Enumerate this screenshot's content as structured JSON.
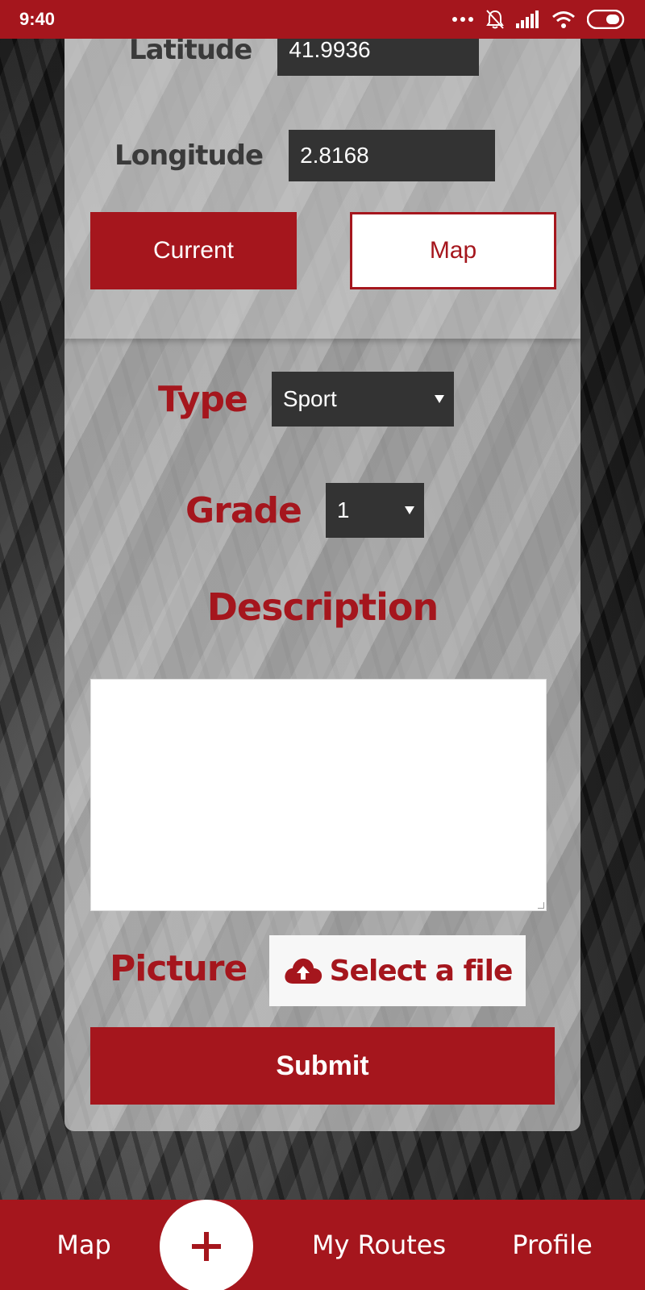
{
  "status_bar": {
    "time": "9:40",
    "icons": [
      "more-dots-icon",
      "bell-off-icon",
      "signal-icon",
      "wifi-icon",
      "battery-icon"
    ]
  },
  "location": {
    "latitude_label": "Latitude",
    "latitude_value": "41.9936",
    "longitude_label": "Longitude",
    "longitude_value": "2.8168",
    "current_button": "Current",
    "map_button": "Map"
  },
  "form": {
    "type_label": "Type",
    "type_value": "Sport",
    "grade_label": "Grade",
    "grade_value": "1",
    "description_label": "Description",
    "description_value": "",
    "picture_label": "Picture",
    "select_file_label": "Select a file",
    "submit_label": "Submit"
  },
  "bottom_nav": {
    "items": [
      "Map",
      "My Routes",
      "Profile"
    ],
    "fab_icon": "plus-icon"
  },
  "colors": {
    "brand": "#a5161d",
    "input_dark": "#333333"
  }
}
